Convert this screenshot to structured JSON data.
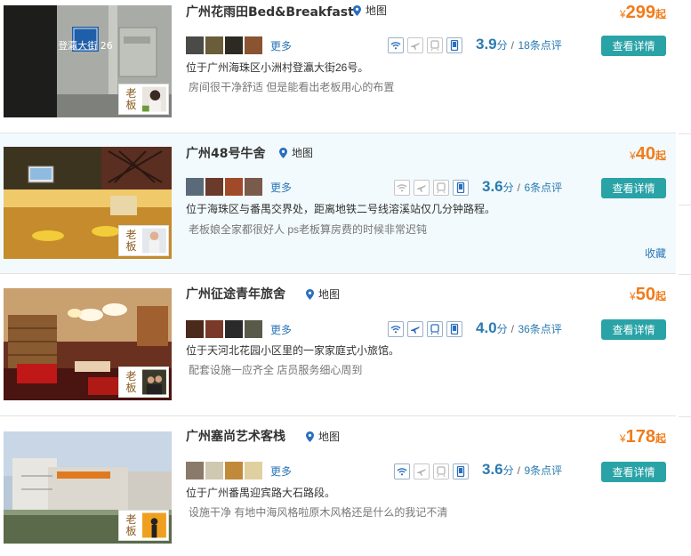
{
  "listings": [
    {
      "name": "广州花雨田Bed&Breakfast",
      "map_label": "地图",
      "price_currency": "¥",
      "price": "299",
      "price_suffix": "起",
      "more_label": "更多",
      "score": "3.9",
      "score_unit": "分",
      "separator": "/",
      "reviews": "18条点评",
      "button_label": "查看详情",
      "address": "位于广州海珠区小洲村登瀛大街26号。",
      "comment": "房间很干净舒适   但是能看出老板用心的布置",
      "owner_label": "老板",
      "sign_text": "登瀛大街 26",
      "facilities": [
        {
          "icon": "wifi-icon",
          "active": true
        },
        {
          "icon": "airport-icon",
          "active": false
        },
        {
          "icon": "train-icon",
          "active": false
        },
        {
          "icon": "phone-icon",
          "active": true
        }
      ]
    },
    {
      "name": "广州48号牛舍",
      "map_label": "地图",
      "price_currency": "¥",
      "price": "40",
      "price_suffix": "起",
      "more_label": "更多",
      "score": "3.6",
      "score_unit": "分",
      "separator": "/",
      "reviews": "6条点评",
      "button_label": "查看详情",
      "address": "位于海珠区与番禺交界处，距离地铁二号线溶溪站仅几分钟路程。",
      "comment": "老板娘全家都很好人   ps老板算房费的时候非常迟钝",
      "owner_label": "老板",
      "favorite_label": "收藏",
      "facilities": [
        {
          "icon": "wifi-icon",
          "active": false
        },
        {
          "icon": "airport-icon",
          "active": false
        },
        {
          "icon": "train-icon",
          "active": false
        },
        {
          "icon": "phone-icon",
          "active": true
        }
      ]
    },
    {
      "name": "广州征途青年旅舍",
      "map_label": "地图",
      "price_currency": "¥",
      "price": "50",
      "price_suffix": "起",
      "more_label": "更多",
      "score": "4.0",
      "score_unit": "分",
      "separator": "/",
      "reviews": "36条点评",
      "button_label": "查看详情",
      "address": "位于天河北花园小区里的一家家庭式小旅馆。",
      "comment": "配套设施一应齐全   店员服务细心周到",
      "owner_label": "老板",
      "facilities": [
        {
          "icon": "wifi-icon",
          "active": true
        },
        {
          "icon": "airport-icon",
          "active": true
        },
        {
          "icon": "train-icon",
          "active": true
        },
        {
          "icon": "phone-icon",
          "active": true
        }
      ]
    },
    {
      "name": "广州塞尚艺术客栈",
      "map_label": "地图",
      "price_currency": "¥",
      "price": "178",
      "price_suffix": "起",
      "more_label": "更多",
      "score": "3.6",
      "score_unit": "分",
      "separator": "/",
      "reviews": "9条点评",
      "button_label": "查看详情",
      "address": "位于广州番禺迎宾路大石路段。",
      "comment": "设施干净   有地中海风格啦原木风格还是什么的我记不清",
      "owner_label": "老板",
      "facilities": [
        {
          "icon": "wifi-icon",
          "active": true
        },
        {
          "icon": "airport-icon",
          "active": false
        },
        {
          "icon": "train-icon",
          "active": false
        },
        {
          "icon": "phone-icon",
          "active": true
        }
      ]
    }
  ],
  "colors": {
    "price": "#f07c1a",
    "score": "#2a7ab0",
    "link": "#2c75b8",
    "button": "#2aa3a7",
    "highlight_row": "#f2fafd",
    "map_pin": "#2a6fbf"
  }
}
